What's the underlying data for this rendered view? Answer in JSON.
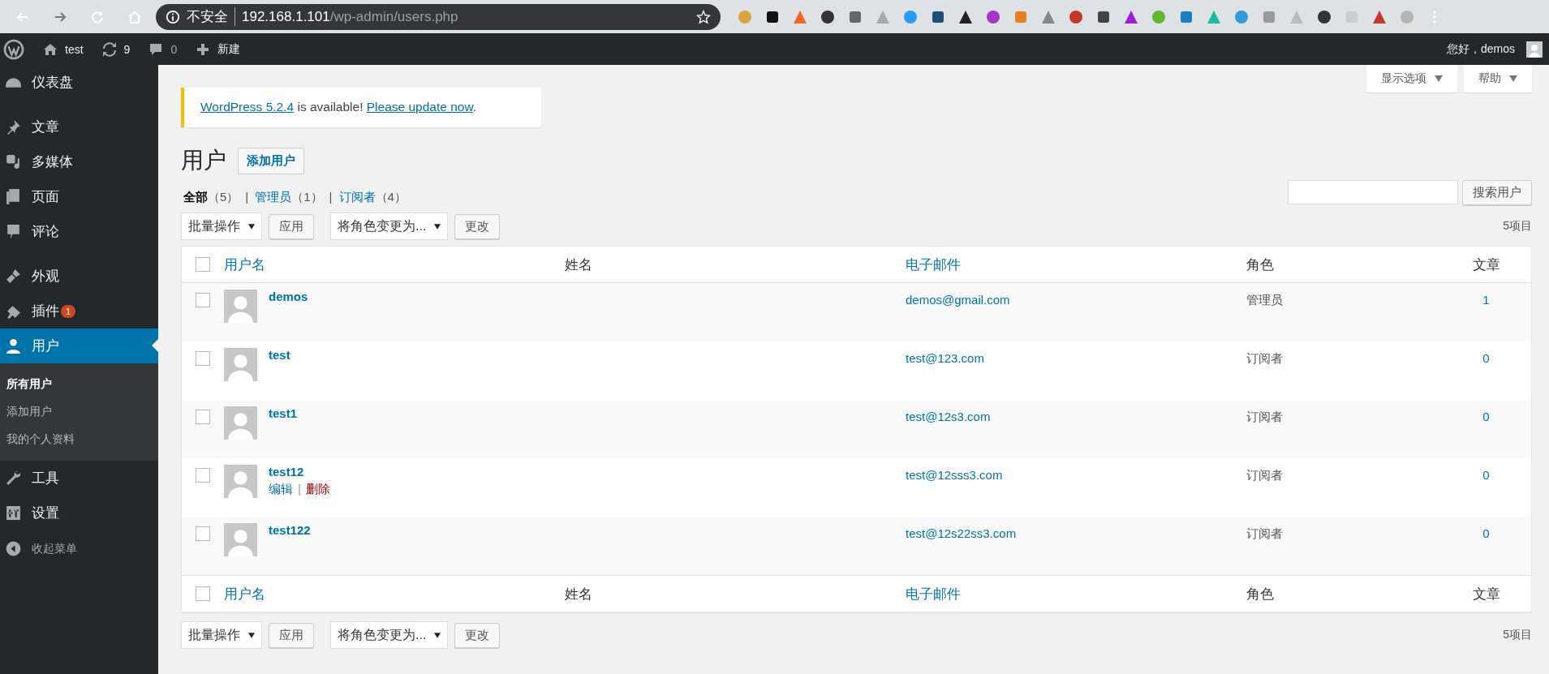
{
  "browser": {
    "security": "不安全",
    "host": "192.168.1.101",
    "path": "/wp-admin/users.php",
    "extensions": [
      {
        "color": "#d9a441"
      },
      {
        "color": "#111111"
      },
      {
        "color": "#f26522"
      },
      {
        "color": "#333333"
      },
      {
        "color": "#666666"
      },
      {
        "color": "#aaaaaa"
      },
      {
        "color": "#2b9af3"
      },
      {
        "color": "#1f4e79"
      },
      {
        "color": "#222222"
      },
      {
        "color": "#a335c9"
      },
      {
        "color": "#e67e22"
      },
      {
        "color": "#888888"
      },
      {
        "color": "#c0392b"
      },
      {
        "color": "#444444"
      },
      {
        "color": "#9b1fd6"
      },
      {
        "color": "#5fb832"
      },
      {
        "color": "#1a7fc1"
      },
      {
        "color": "#1abc9c"
      },
      {
        "color": "#3498db"
      },
      {
        "color": "#999999"
      },
      {
        "color": "#bbbbbb"
      },
      {
        "color": "#333334"
      },
      {
        "color": "#cccccc"
      },
      {
        "color": "#c0392c"
      },
      {
        "color": "#b5b5b5"
      }
    ]
  },
  "admin_bar": {
    "site": "test",
    "updates": "9",
    "comments": "0",
    "new": "新建",
    "greeting": "您好，demos"
  },
  "sidebar": {
    "groups": [
      {
        "items": [
          {
            "label": "仪表盘",
            "kind": "dashboard",
            "selected": false
          }
        ]
      },
      {
        "items": [
          {
            "label": "文章",
            "kind": "pin",
            "selected": false
          },
          {
            "label": "多媒体",
            "kind": "media",
            "selected": false
          },
          {
            "label": "页面",
            "kind": "page",
            "selected": false
          },
          {
            "label": "评论",
            "kind": "comment",
            "selected": false
          }
        ]
      },
      {
        "items": [
          {
            "label": "外观",
            "kind": "brush",
            "selected": false
          },
          {
            "label": "插件",
            "kind": "plugin",
            "selected": false,
            "badge": "1"
          },
          {
            "label": "用户",
            "kind": "user",
            "selected": true,
            "children": [
              {
                "label": "所有用户",
                "selected": true
              },
              {
                "label": "添加用户",
                "selected": false
              },
              {
                "label": "我的个人资料",
                "selected": false
              }
            ]
          },
          {
            "label": "工具",
            "kind": "wrench",
            "selected": false
          },
          {
            "label": "设置",
            "kind": "settings",
            "selected": false
          }
        ]
      }
    ],
    "collapse": "收起菜单"
  },
  "screen_meta": [
    "显示选项",
    "帮助"
  ],
  "notice": {
    "link1": "WordPress 5.2.4",
    "text": " is available! ",
    "link2": "Please update now",
    "end": "."
  },
  "page_title": "用户",
  "add_button": "添加用户",
  "filters": [
    {
      "label": "全部",
      "count": "（5）",
      "selected": true
    },
    {
      "separator": "|",
      "label": "管理员",
      "count": "（1）",
      "selected": false
    },
    {
      "separator": "|",
      "label": "订阅者",
      "count": "（4）",
      "selected": false
    }
  ],
  "search_button": "搜索用户",
  "top_actions": {
    "bulk": "批量操作",
    "apply": "应用",
    "role": "将角色变更为...",
    "change": "更改",
    "count": "5项目"
  },
  "table": {
    "select_all_checked": false,
    "footer_select_all_checked": false,
    "columns": [
      "用户名",
      "姓名",
      "电子邮件",
      "角色",
      "文章"
    ],
    "rows": [
      {
        "username": "demos",
        "email": "demos@gmail.com",
        "role": "管理员",
        "posts": "1",
        "checked": false
      },
      {
        "username": "test",
        "email": "test@123.com",
        "role": "订阅者",
        "posts": "0",
        "checked": false
      },
      {
        "username": "test1",
        "email": "test@12s3.com",
        "role": "订阅者",
        "posts": "0",
        "checked": false
      },
      {
        "username": "test12",
        "email": "test@12sss3.com",
        "role": "订阅者",
        "posts": "0",
        "checked": false,
        "actions": [
          {
            "label": "编辑",
            "danger": false
          },
          {
            "separator": "|",
            "label": "删除",
            "danger": true
          }
        ]
      },
      {
        "username": "test122",
        "email": "test@12s22ss3.com",
        "role": "订阅者",
        "posts": "0",
        "checked": false
      }
    ],
    "footer_columns": [
      "用户名",
      "姓名",
      "电子邮件",
      "角色",
      "文章"
    ]
  },
  "bottom_actions": {
    "bulk": "批量操作",
    "apply": "应用",
    "role": "将角色变更为...",
    "change": "更改",
    "count": "5项目"
  }
}
